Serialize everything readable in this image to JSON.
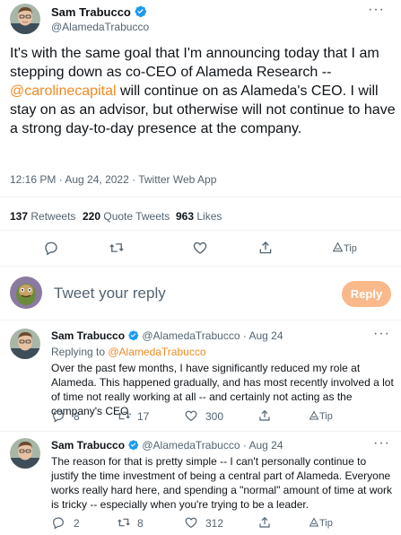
{
  "main_tweet": {
    "display_name": "Sam Trabucco",
    "handle": "@AlamedaTrabucco",
    "body_before": "It's with the same goal that I'm announcing today that I am stepping down as co-CEO of Alameda Research -- ",
    "mention": "@carolinecapital",
    "body_after": " will continue on as Alameda's CEO. I will stay on as an advisor, but otherwise will not continue to have a strong day-to-day presence at the company.",
    "meta": "12:16 PM · Aug 24, 2022 · Twitter Web App",
    "stats": {
      "retweets_count": "137",
      "retweets_label": "Retweets",
      "quotes_count": "220",
      "quotes_label": "Quote Tweets",
      "likes_count": "963",
      "likes_label": "Likes"
    },
    "actions": {
      "tip_label": "Tip"
    }
  },
  "composer": {
    "placeholder": "Tweet your reply",
    "reply_button": "Reply"
  },
  "replies": [
    {
      "display_name": "Sam Trabucco",
      "handle_time": "@AlamedaTrabucco · Aug 24",
      "replying_prefix": "Replying to ",
      "replying_to": "@AlamedaTrabucco",
      "body": "Over the past few months, I have significantly reduced my role at Alameda. This happened gradually, and has most recently involved a lot of time not really working at all -- and certainly not acting as the company's CEO.",
      "reply_count": "8",
      "retweet_count": "17",
      "like_count": "300",
      "tip_label": "Tip"
    },
    {
      "display_name": "Sam Trabucco",
      "handle_time": "@AlamedaTrabucco · Aug 24",
      "body": "The reason for that is pretty simple -- I can't personally continue to justify the time investment of being a central part of Alameda. Everyone works really hard here, and spending a \"normal\" amount of time at work is tricky -- especially when you're trying to be a leader.",
      "reply_count": "2",
      "retweet_count": "8",
      "like_count": "312",
      "tip_label": "Tip"
    }
  ],
  "colors": {
    "link": "#f08a24",
    "verified": "#1d9bf0",
    "reply_button": "#f9b98a",
    "muted": "#536471"
  }
}
